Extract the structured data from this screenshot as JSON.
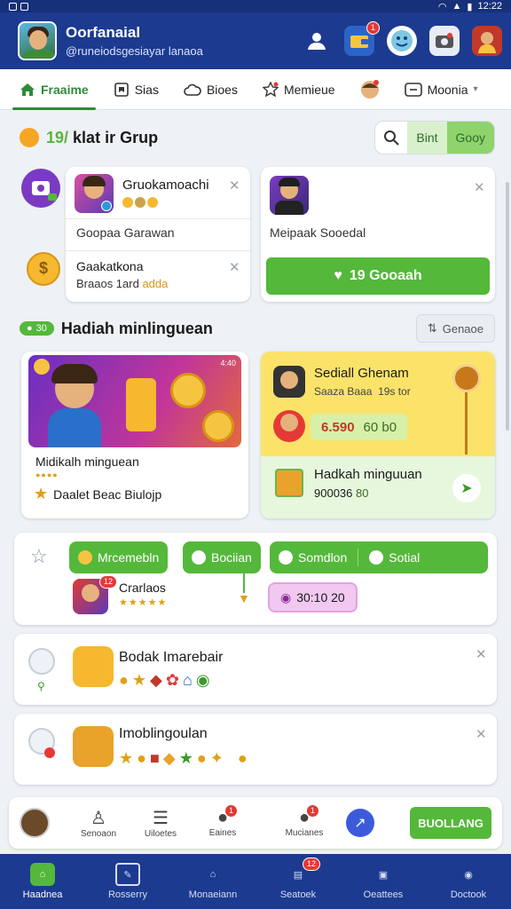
{
  "status_bar": {
    "time": "12:22"
  },
  "header": {
    "title": "Oorfanaial",
    "subtitle": "@runeiodsgesiayar lanaoa",
    "badge_1": "1",
    "colors": {
      "bar": "#1c3a8f",
      "accent": "#54b83a"
    }
  },
  "tabs": [
    {
      "label": "Fraaime",
      "icon": "home-icon"
    },
    {
      "label": "Sias",
      "icon": "bookmark-icon"
    },
    {
      "label": "Bioes",
      "icon": "cloud-icon"
    },
    {
      "label": "Memieue",
      "icon": "star-icon"
    },
    {
      "label": "",
      "icon": "avatar-icon"
    },
    {
      "label": "Moonia",
      "icon": "chat-icon"
    }
  ],
  "group_section": {
    "title_highlight": "19/",
    "title": "klat ir Grup",
    "segment_1": "Bint",
    "segment_2": "Gooy"
  },
  "left_card": {
    "name": "Gruokamoachi",
    "row_text": "Goopaa Garawan",
    "second_title": "Gaakatkona",
    "second_sub": "Braaos 1ard",
    "second_sub_highlight": "adda"
  },
  "right_card": {
    "label": "Meipaak Sooedal",
    "button": "19 Gooaah"
  },
  "weekly_section": {
    "badge": "30",
    "title": "Hadiah minlinguean",
    "button": "Genaoe"
  },
  "weekly_card": {
    "caption": "Midikalh minguean",
    "sub": "Daalet Beac Biulojp",
    "image_tag": "4:40"
  },
  "right_panel": {
    "title": "Sediall Ghenam",
    "sub": "Saaza Baaa",
    "sub_right": "19s tor",
    "amount": "6.590",
    "amount_right": "60 b0",
    "bottom_title": "Hadkah minguuan",
    "bottom_sub": "900036 ",
    "bottom_sub_highlight": "80"
  },
  "actions_card": {
    "pill_1": "Mrcemebln",
    "pill_2": "Bociian",
    "pill_3": "Somdlon",
    "pill_4": "Sotial",
    "user_name": "Crarlaos",
    "timer": "30:10 20",
    "badge": "12"
  },
  "reward_1": {
    "title": "Bodak Imarebair"
  },
  "reward_2": {
    "title": "Imoblingoulan"
  },
  "dock": {
    "items": [
      {
        "label": "Senoaon",
        "icon": "user-icon"
      },
      {
        "label": "Uiloetes",
        "icon": "document-icon"
      },
      {
        "label": "Eaines",
        "icon": "chat-bubble-icon",
        "badge": "1"
      },
      {
        "label": "Mucianes",
        "icon": "people-icon",
        "badge": "1"
      }
    ],
    "button": "BUOLLANG"
  },
  "nav": {
    "items": [
      {
        "label": "Haadnea",
        "icon": "home-icon"
      },
      {
        "label": "Rosserry",
        "icon": "edit-icon"
      },
      {
        "label": "Monaeiann",
        "icon": "store-icon"
      },
      {
        "label": "Seatoek",
        "icon": "list-icon",
        "badge": "12"
      },
      {
        "label": "Oeattees",
        "icon": "gallery-icon"
      },
      {
        "label": "Doctook",
        "icon": "profile-icon"
      }
    ]
  }
}
